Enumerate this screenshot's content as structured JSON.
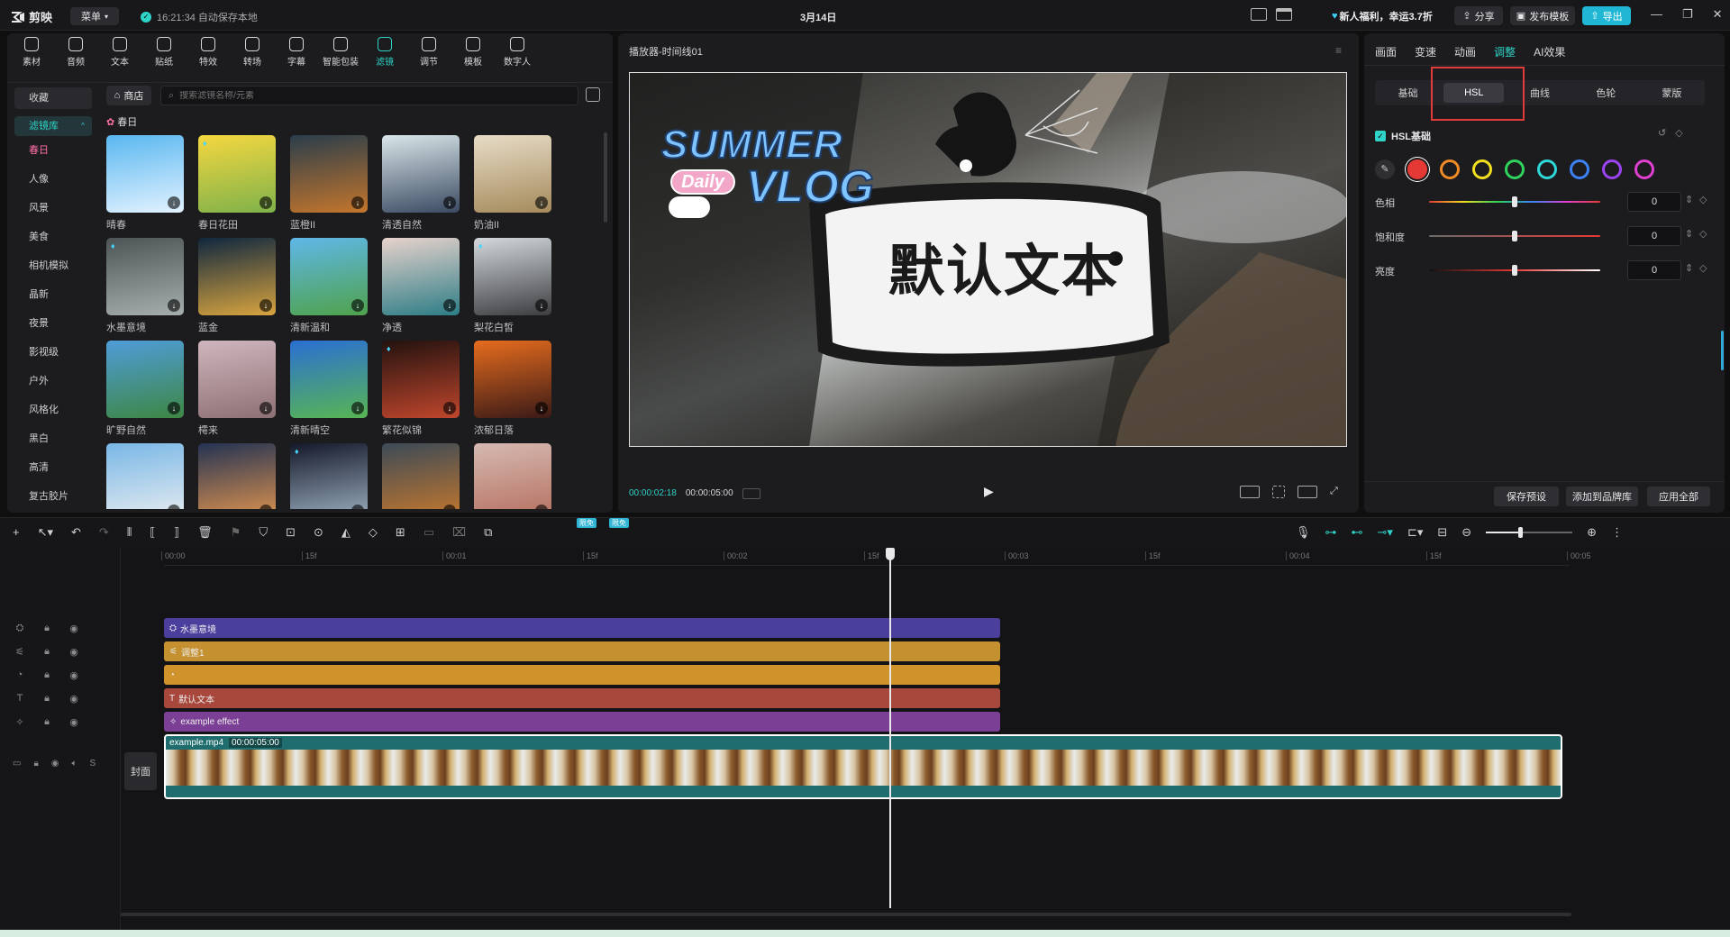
{
  "app": {
    "logo": "剪映",
    "menu": "菜单",
    "autosave": "16:21:34 自动保存本地",
    "date": "3月14日",
    "promo": "新人福利，幸运3.7折",
    "share": "分享",
    "publish_template": "发布模板",
    "export": "导出"
  },
  "toolbar": [
    {
      "label": "素材",
      "icon": "media-icon"
    },
    {
      "label": "音频",
      "icon": "audio-icon"
    },
    {
      "label": "文本",
      "icon": "text-icon"
    },
    {
      "label": "贴纸",
      "icon": "sticker-icon"
    },
    {
      "label": "特效",
      "icon": "effects-icon"
    },
    {
      "label": "转场",
      "icon": "transition-icon"
    },
    {
      "label": "字幕",
      "icon": "subtitle-icon"
    },
    {
      "label": "智能包装",
      "icon": "smart-package-icon"
    },
    {
      "label": "滤镜",
      "icon": "filter-icon"
    },
    {
      "label": "调节",
      "icon": "adjust-icon"
    },
    {
      "label": "模板",
      "icon": "template-icon"
    },
    {
      "label": "数字人",
      "icon": "avatar-icon"
    }
  ],
  "sidebar": {
    "favorites": "收藏",
    "library": "滤镜库",
    "items": [
      "春日",
      "人像",
      "风景",
      "美食",
      "相机模拟",
      "晶新",
      "夜景",
      "影视级",
      "户外",
      "风格化",
      "黑白",
      "高清",
      "复古胶片"
    ]
  },
  "store": {
    "label": "商店",
    "search_placeholder": "搜索滤镜名称/元素"
  },
  "section_title": "春日",
  "filters": [
    {
      "label": "晴春",
      "colors": [
        "#59b7f0",
        "#e2f2ff"
      ]
    },
    {
      "label": "春日花田",
      "colors": [
        "#f5d740",
        "#7fb24a"
      ]
    },
    {
      "label": "蓝橙II",
      "colors": [
        "#2a3d4b",
        "#c4762c"
      ]
    },
    {
      "label": "清透自然",
      "colors": [
        "#d9e6e9",
        "#3b4a62"
      ]
    },
    {
      "label": "奶油II",
      "colors": [
        "#e7dcc7",
        "#a58a5b"
      ]
    },
    {
      "label": "水墨意境",
      "colors": [
        "#4c5455",
        "#a7afae"
      ]
    },
    {
      "label": "蓝金",
      "colors": [
        "#10273f",
        "#d8a43f"
      ]
    },
    {
      "label": "清新温和",
      "colors": [
        "#5fb7e8",
        "#4fa24b"
      ]
    },
    {
      "label": "净透",
      "colors": [
        "#e7d2cc",
        "#2d7d86"
      ]
    },
    {
      "label": "梨花白皙",
      "colors": [
        "#d3d8dc",
        "#3c3d40"
      ]
    },
    {
      "label": "旷野自然",
      "colors": [
        "#4f9cd9",
        "#3d8744"
      ]
    },
    {
      "label": "樗来",
      "colors": [
        "#cfb6bd",
        "#8d7074"
      ]
    },
    {
      "label": "清新晴空",
      "colors": [
        "#2a6fd3",
        "#58b553"
      ]
    },
    {
      "label": "繁花似锦",
      "colors": [
        "#23120f",
        "#c0462c"
      ]
    },
    {
      "label": "浓郁日落",
      "colors": [
        "#e66c1e",
        "#3b1a17"
      ]
    },
    {
      "label": "",
      "colors": [
        "#79b7e6",
        "#e8edf0"
      ]
    },
    {
      "label": "",
      "colors": [
        "#243353",
        "#e2954f"
      ]
    },
    {
      "label": "",
      "colors": [
        "#15192a",
        "#9eb2c4"
      ]
    },
    {
      "label": "",
      "colors": [
        "#3c4a57",
        "#c8792c"
      ]
    },
    {
      "label": "",
      "colors": [
        "#d5b9b1",
        "#b56e5e"
      ]
    }
  ],
  "player": {
    "title": "播放器-时间线01",
    "current_time": "00:00:02:18",
    "total_time": "00:00:05:00",
    "overlay_text": "默认文本",
    "sticker_summer": "SUMMER",
    "sticker_vlog": "VLOG",
    "sticker_daily": "Daily"
  },
  "inspector": {
    "tabs": [
      "画面",
      "变速",
      "动画",
      "调整",
      "AI效果"
    ],
    "active_tab": "调整",
    "subtabs": [
      "基础",
      "HSL",
      "曲线",
      "色轮",
      "蒙版"
    ],
    "active_subtab": "HSL",
    "hsl_title": "HSL基础",
    "swatches": [
      "#e53935",
      "#f08a24",
      "#f2e020",
      "#2fd35b",
      "#2fd8d8",
      "#3b82f6",
      "#9b44f0",
      "#e23fd3"
    ],
    "rows": [
      {
        "label": "色相",
        "value": "0",
        "level": 0.5
      },
      {
        "label": "饱和度",
        "value": "0",
        "level": 0.5
      },
      {
        "label": "亮度",
        "value": "0",
        "level": 0.5
      }
    ],
    "save_preset": "保存预设",
    "add_brand": "添加到品牌库",
    "apply_all": "应用全部"
  },
  "timeline": {
    "ruler": [
      "00:00",
      "15f",
      "00:01",
      "15f",
      "00:02",
      "15f",
      "00:03",
      "15f",
      "00:04",
      "15f",
      "00:05"
    ],
    "badge_free": "限免",
    "tracks": [
      {
        "label": "水墨意境",
        "color": "#4b3f9e",
        "icon": "filter-icon"
      },
      {
        "label": "调整1",
        "color": "#c5902f",
        "icon": "adjust-icon"
      },
      {
        "label": "",
        "color": "#d0922a",
        "icon": "sticker-icon"
      },
      {
        "label": "默认文本",
        "color": "#a8473b",
        "icon": "text-icon"
      },
      {
        "label": "example effect",
        "color": "#7b3f95",
        "icon": "effects-icon"
      }
    ],
    "main_clip": {
      "name": "example.mp4",
      "duration": "00:00:05:00"
    },
    "cover": "封面",
    "track_s": "S"
  }
}
